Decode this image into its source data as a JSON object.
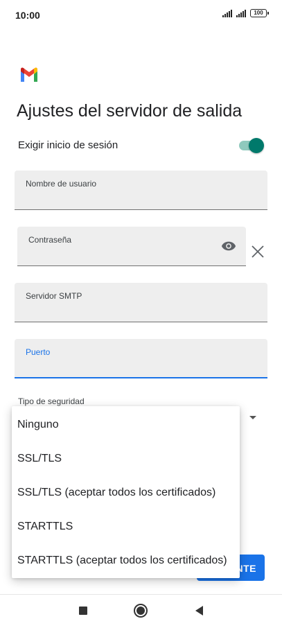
{
  "status_bar": {
    "time": "10:00",
    "battery": "100",
    "signal_icon": "signal-icon",
    "battery_icon": "battery-icon"
  },
  "header": {
    "logo_icon": "gmail-logo-icon",
    "title": "Ajustes del servidor de salida"
  },
  "login_toggle": {
    "label": "Exigir inicio de sesión",
    "checked": true,
    "accent": "#00796b"
  },
  "fields": {
    "username": {
      "label": "Nombre de usuario",
      "value": ""
    },
    "password": {
      "label": "Contraseña",
      "value": "",
      "eye_icon": "eye-icon",
      "clear_icon": "close-icon"
    },
    "smtp_server": {
      "label": "Servidor SMTP",
      "value": ""
    },
    "port": {
      "label": "Puerto",
      "value": "",
      "focused": true
    }
  },
  "security": {
    "label": "Tipo de seguridad",
    "dropdown_open": true,
    "options": [
      "Ninguno",
      "SSL/TLS",
      "SSL/TLS (aceptar todos los certificados)",
      "STARTTLS",
      "STARTTLS (aceptar todos los certificados)"
    ]
  },
  "next_button": {
    "label_visible": "NTE"
  },
  "nav_bar": {
    "recents_icon": "square-icon",
    "home_icon": "circle-icon",
    "back_icon": "back-triangle-icon"
  },
  "colors": {
    "primary_blue": "#1a73e8",
    "toggle_teal": "#00796b",
    "field_bg": "#eeeeee"
  }
}
